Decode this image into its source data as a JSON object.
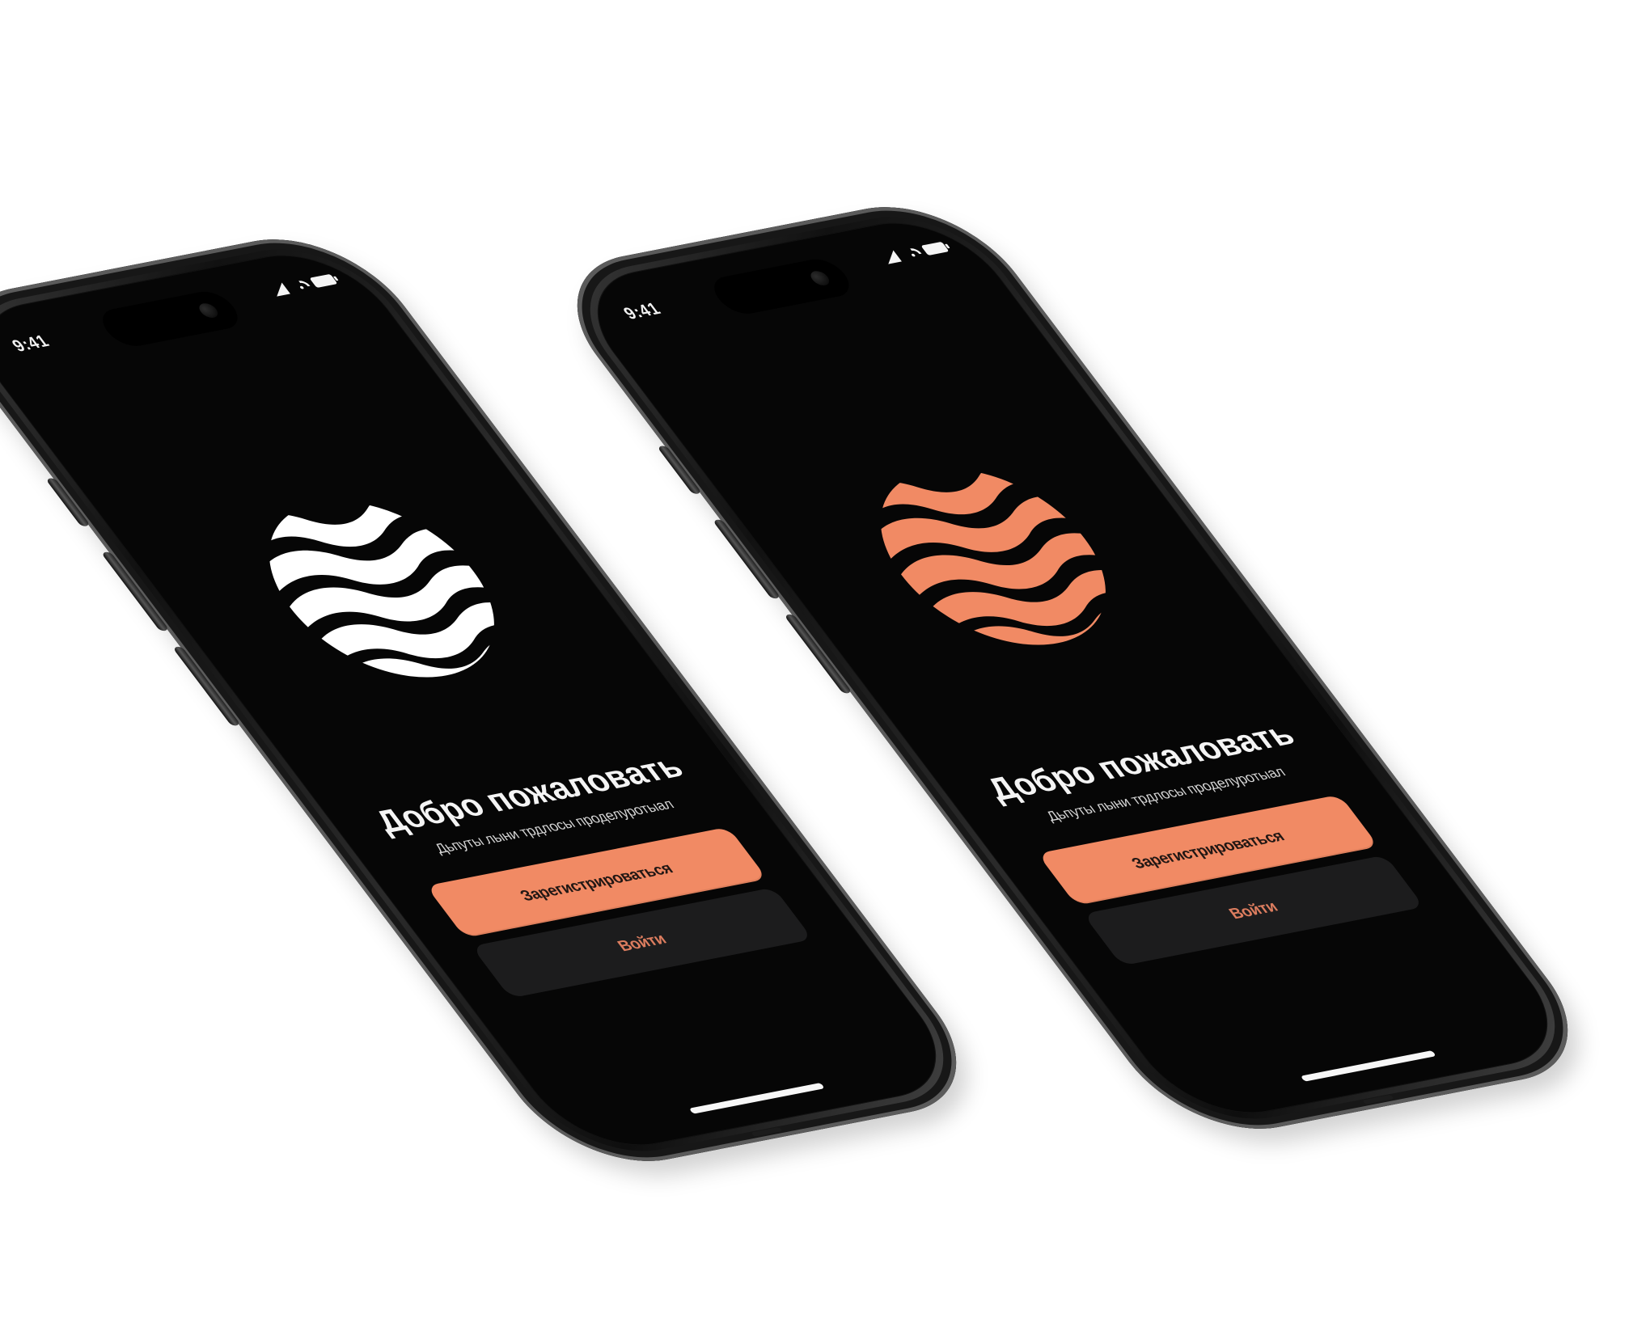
{
  "page": {
    "background_color": "#ffffff"
  },
  "colors": {
    "screen_background": "#060606",
    "accent": "#f18a64",
    "secondary_button": "#1c1c1d",
    "logo_white": "#ffffff",
    "logo_orange": "#f18a64"
  },
  "phones": [
    {
      "status_time": "9:41",
      "logo_icon": "wave-sphere-icon",
      "logo_color": "white",
      "title": "Добро пожаловать",
      "subtitle": "Дьпуты лыни трдлосы проделуротыал",
      "primary_button_label": "Зарегистрироваться",
      "secondary_button_label": "Войти"
    },
    {
      "status_time": "9:41",
      "logo_icon": "wave-sphere-icon",
      "logo_color": "orange",
      "title": "Добро пожаловать",
      "subtitle": "Дьпуты лыни трдлосы проделуротыал",
      "primary_button_label": "Зарегистрироваться",
      "secondary_button_label": "Войти"
    }
  ]
}
